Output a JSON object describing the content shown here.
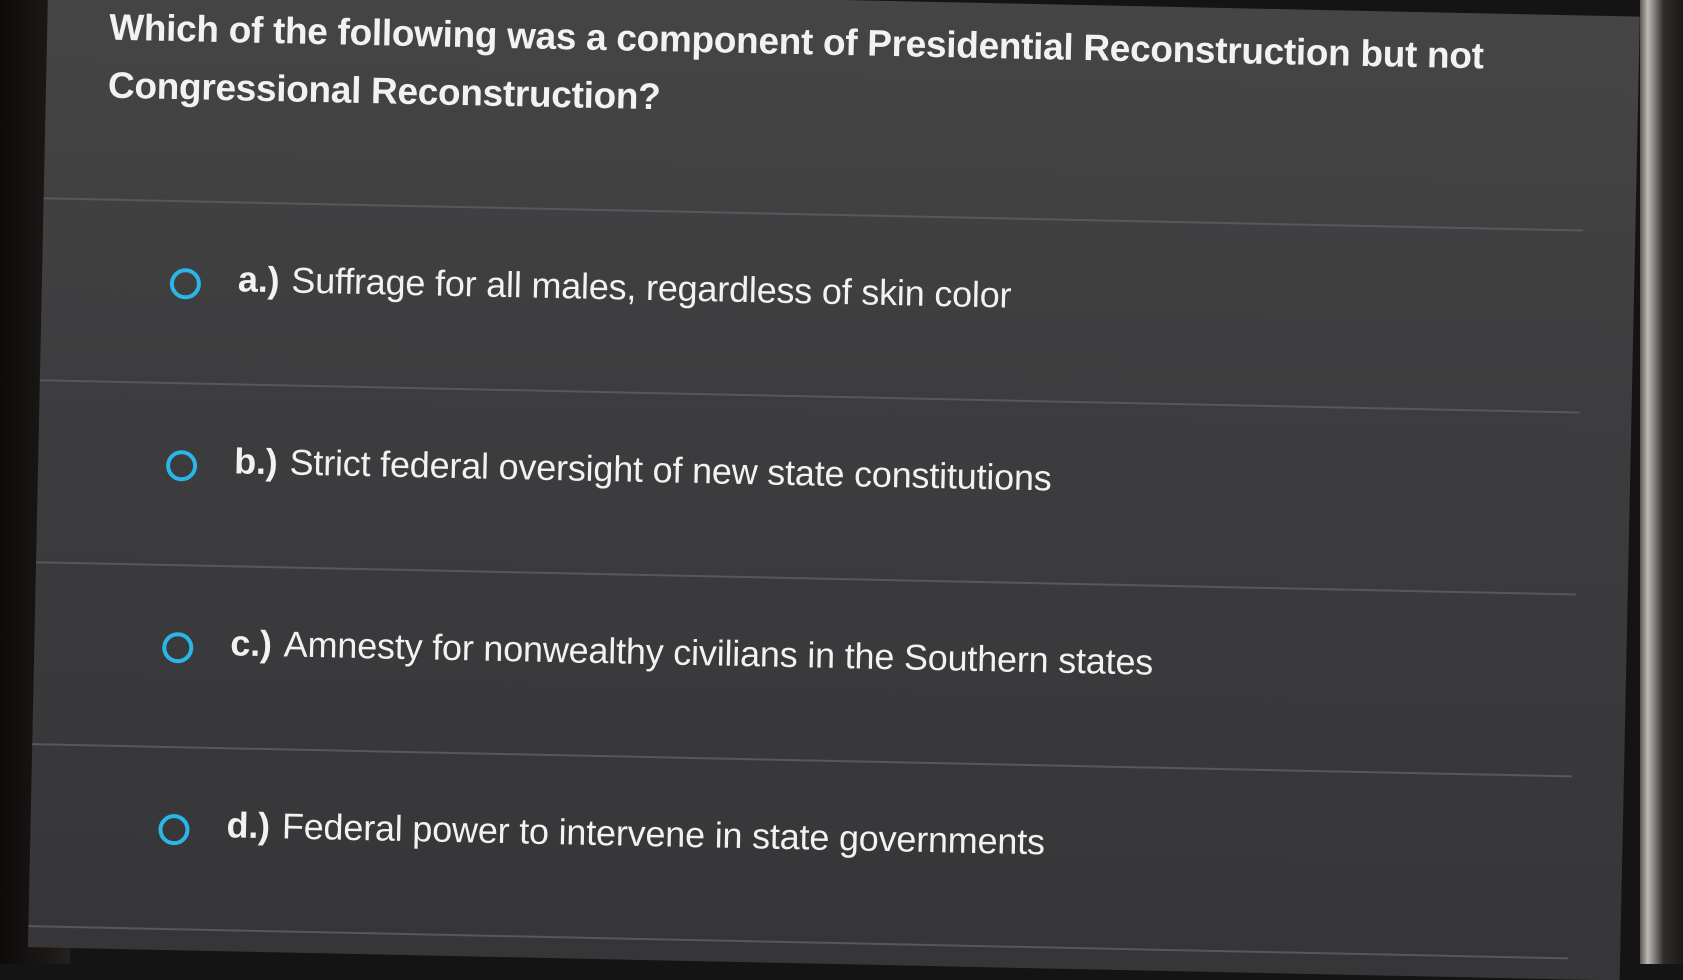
{
  "question": {
    "text": "Which of the following was a component of Presidential Reconstruction but not Congressional Reconstruction?"
  },
  "options": [
    {
      "letter": "a.)",
      "text": "Suffrage for all males, regardless of skin color"
    },
    {
      "letter": "b.)",
      "text": "Strict federal oversight of new state constitutions"
    },
    {
      "letter": "c.)",
      "text": "Amnesty for nonwealthy civilians in the Southern states"
    },
    {
      "letter": "d.)",
      "text": "Federal power to intervene in state governments"
    }
  ],
  "colors": {
    "radio_accent": "#2bb6e8",
    "background": "#3d3d3f",
    "text": "#f2f2f2"
  }
}
